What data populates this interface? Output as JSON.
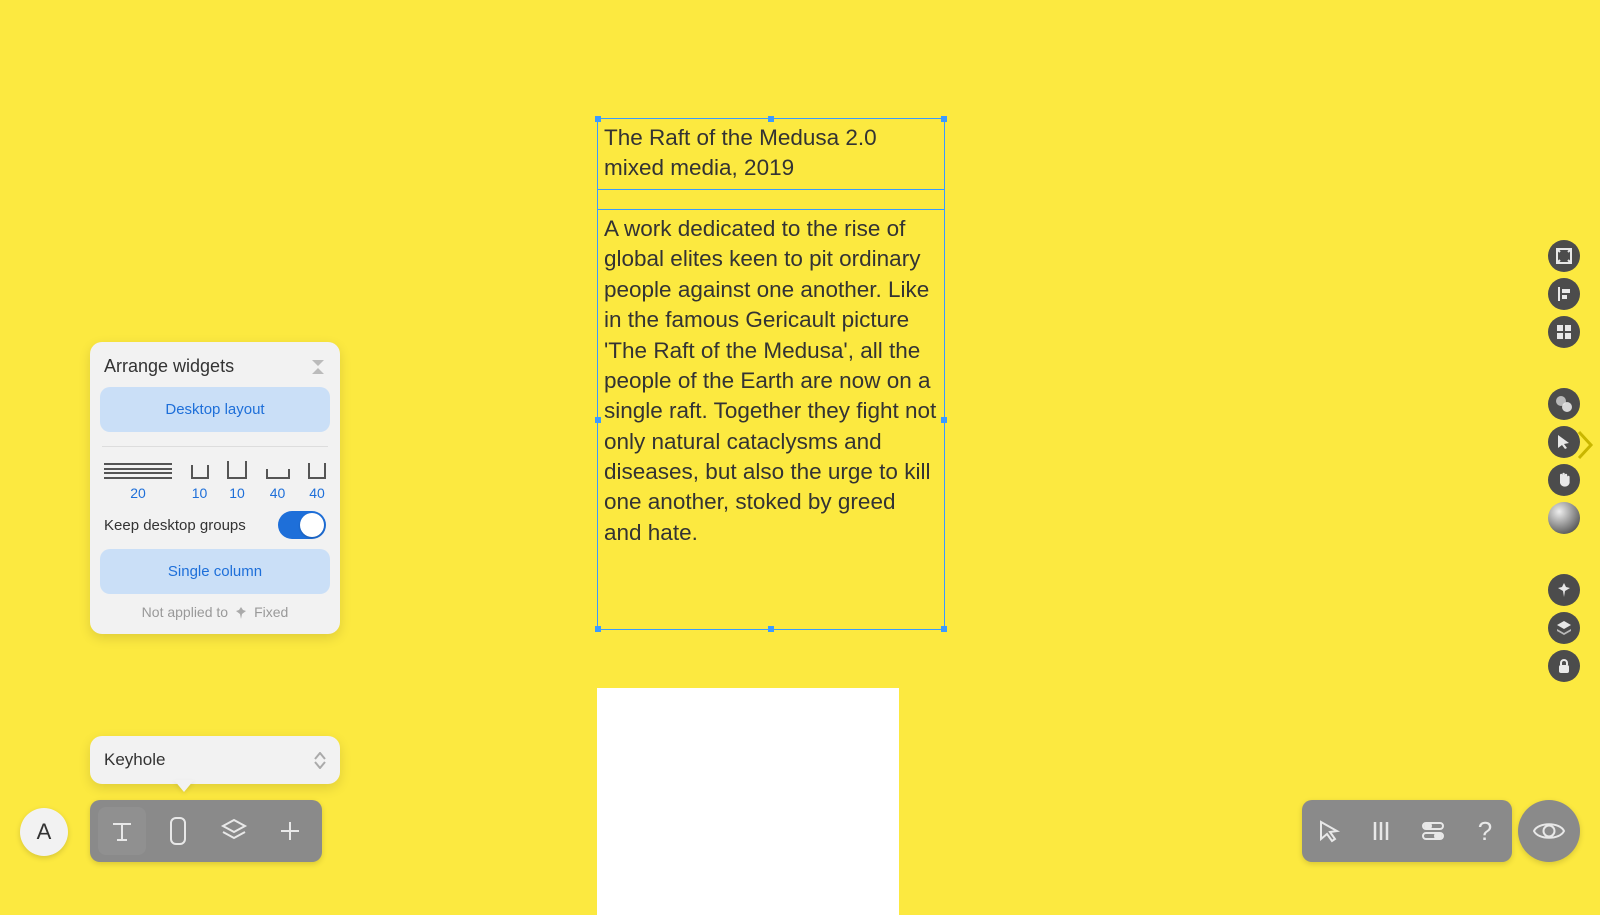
{
  "canvas": {
    "title_line1": "The Raft of the Medusa 2.0",
    "title_line2": "mixed media, 2019",
    "body_text": "A work dedicated to the rise of global elites keen to pit ordinary people against one another. Like in the famous Gericault picture 'The Raft of the Medusa', all the people of the Earth are now on a single raft. Together they fight not only natural cataclysms and diseases, but also the urge to kill one another, stoked by greed and hate."
  },
  "arrange_panel": {
    "title": "Arrange widgets",
    "desktop_layout_button": "Desktop layout",
    "thumbs": [
      "20",
      "10",
      "10",
      "40",
      "40"
    ],
    "keep_groups_label": "Keep desktop groups",
    "keep_groups_on": true,
    "single_column_button": "Single column",
    "hint_prefix": "Not applied to",
    "hint_suffix": "Fixed"
  },
  "keyhole_panel": {
    "label": "Keyhole"
  },
  "bottom_left": {
    "a_label": "A",
    "items": [
      {
        "name": "typography-tool-icon"
      },
      {
        "name": "mobile-preview-icon"
      },
      {
        "name": "layers-icon"
      },
      {
        "name": "add-icon"
      }
    ]
  },
  "bottom_right": {
    "items": [
      {
        "name": "pointer-outline-icon"
      },
      {
        "name": "columns-icon"
      },
      {
        "name": "slider-controls-icon"
      },
      {
        "name": "help-icon",
        "glyph": "?"
      }
    ],
    "eye": "preview-eye-icon"
  },
  "right_rail": {
    "group1": [
      {
        "name": "fit-frame-icon"
      },
      {
        "name": "align-left-icon"
      },
      {
        "name": "grid-icon"
      }
    ],
    "group2": [
      {
        "name": "snap-icon"
      },
      {
        "name": "cursor-fill-icon"
      },
      {
        "name": "hand-icon"
      },
      {
        "name": "gradient-sphere-icon"
      }
    ],
    "group3": [
      {
        "name": "pin-icon"
      },
      {
        "name": "layers-stack-icon"
      },
      {
        "name": "lock-icon"
      }
    ]
  },
  "colors": {
    "bg": "#FCE940",
    "accent": "#1E6FD9",
    "selection": "#3B9BFF"
  }
}
